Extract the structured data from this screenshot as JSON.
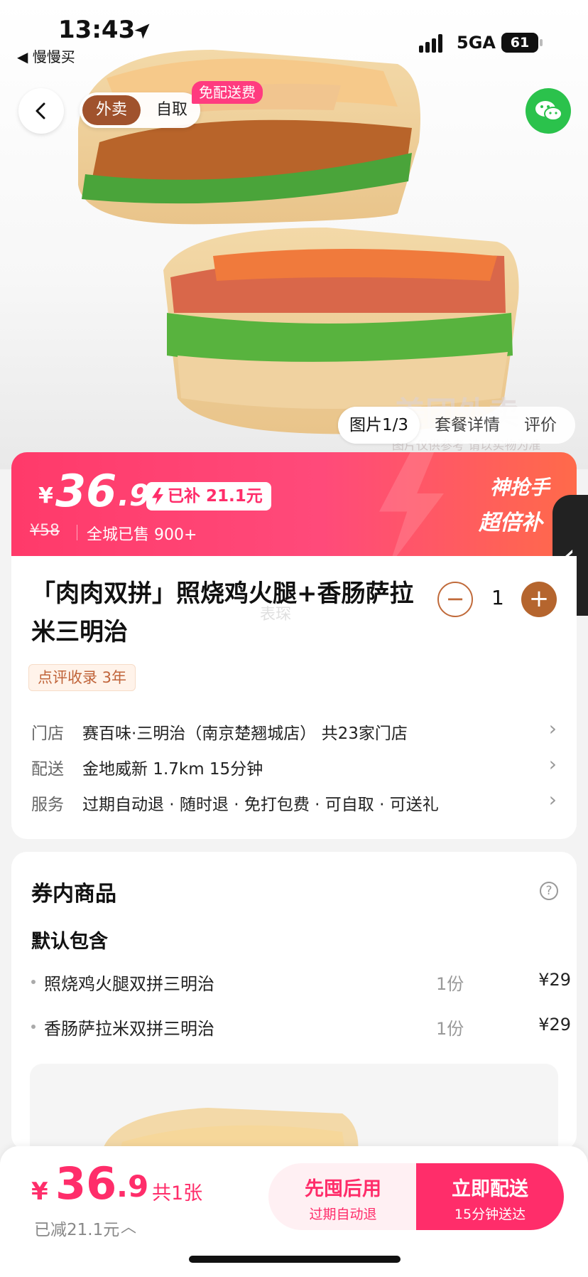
{
  "status_bar": {
    "time": "13:43",
    "back_app": "◀ 慢慢买",
    "network": "5GA",
    "battery": "61"
  },
  "header": {
    "mode_delivery": "外卖",
    "mode_pickup": "自取",
    "free_badge": "免配送费"
  },
  "hero": {
    "watermark": "美团外卖",
    "watermark_sub": "图片仅供参考 请以实物为准",
    "image_tabs": [
      "图片1/3",
      "套餐详情",
      "评价"
    ]
  },
  "price_banner": {
    "currency": "¥",
    "price_int": "36",
    "price_dec": ".9",
    "subsidy": "已补 21.1元",
    "original_price": "¥58",
    "sold": "全城已售 900+",
    "promo_line1": "神抢手",
    "promo_line2": "超倍补"
  },
  "product": {
    "title": "「肉肉双拼」照烧鸡火腿+香肠萨拉米三明治",
    "quantity": "1",
    "faint_text": "表琛",
    "tag": "点评收录 3年",
    "rows": [
      {
        "label": "门店",
        "value": "赛百味·三明治（南京楚翘城店）  共23家门店"
      },
      {
        "label": "配送",
        "value": "金地威新  1.7km  15分钟"
      },
      {
        "label": "服务",
        "value": "过期自动退 · 随时退 · 免打包费 · 可自取 · 可送礼"
      }
    ]
  },
  "coupon": {
    "title": "券内商品",
    "help": "?",
    "default_label": "默认包含",
    "items": [
      {
        "name": "照烧鸡火腿双拼三明治",
        "qty": "1份",
        "price": "¥29"
      },
      {
        "name": "香肠萨拉米双拼三明治",
        "qty": "1份",
        "price": "¥29"
      }
    ]
  },
  "bottom": {
    "currency": "¥",
    "price_int": "36",
    "price_dec": ".9",
    "count": "共1张",
    "saved": "已减21.1元",
    "btn_later_main": "先囤后用",
    "btn_later_sub": "过期自动退",
    "btn_now_main": "立即配送",
    "btn_now_sub": "15分钟送达"
  },
  "colors": {
    "brand_pink": "#ff2d6a",
    "brown": "#b5652e",
    "wechat_green": "#2bc24c"
  }
}
